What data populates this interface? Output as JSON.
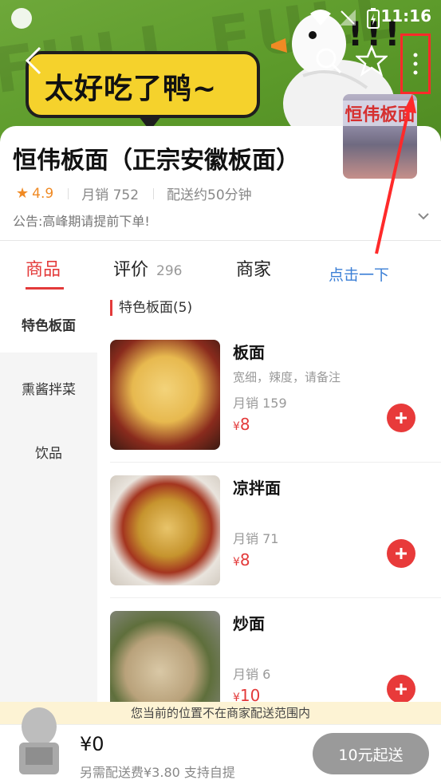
{
  "status_bar": {
    "time": "11:16"
  },
  "banner": {
    "bubble_text": "太好吃了鸭~",
    "bg_text": "FULL FULL",
    "exclaim": "!!!"
  },
  "header": {
    "store_name": "恒伟板面（正宗安徽板面）",
    "rating": "4.9",
    "monthly_sales": "月销 752",
    "delivery_time": "配送约50分钟",
    "notice": "公告:高峰期请提前下单!",
    "store_sign": "恒伟板面"
  },
  "tabs": [
    {
      "label": "商品"
    },
    {
      "label": "评价",
      "count": "296"
    },
    {
      "label": "商家"
    }
  ],
  "annotation": {
    "text": "点击一下"
  },
  "categories": [
    "特色板面",
    "熏酱拌菜",
    "饮品"
  ],
  "section": {
    "title": "特色板面(5)"
  },
  "items": [
    {
      "name": "板面",
      "desc": "宽细，辣度，请备注",
      "sales": "月销 159",
      "currency": "¥",
      "price": "8"
    },
    {
      "name": "凉拌面",
      "desc": "",
      "sales": "月销 71",
      "currency": "¥",
      "price": "8"
    },
    {
      "name": "炒面",
      "desc": "",
      "sales": "月销 6",
      "currency": "¥",
      "price": "10"
    }
  ],
  "range_notice": "您当前的位置不在商家配送范围内",
  "cart": {
    "total": "¥0",
    "fee_text": "另需配送费¥3.80  支持自提",
    "button_label": "10元起送"
  },
  "colors": {
    "accent": "#e33a3a",
    "rating": "#f08a24",
    "annotation": "#3b7fd6",
    "highlight_box": "#ff2a2a"
  }
}
